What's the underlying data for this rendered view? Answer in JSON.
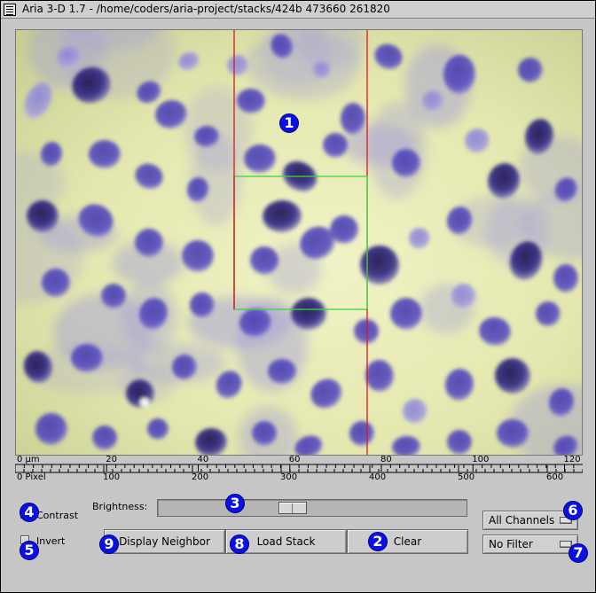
{
  "window": {
    "title": "Aria 3-D 1.7 - /home/coders/aria-project/stacks/424b 473660 261820"
  },
  "ruler": {
    "micron_labels": [
      "0 µm",
      "20",
      "40",
      "60",
      "80",
      "100",
      "120"
    ],
    "micron_values": [
      0,
      20,
      40,
      60,
      80,
      100,
      120
    ],
    "microns_per_pixel": 0.1937,
    "pixel_labels": [
      "0 Pixel",
      "100",
      "200",
      "300",
      "400",
      "500",
      "600"
    ],
    "pixel_values": [
      0,
      100,
      200,
      300,
      400,
      500,
      600
    ]
  },
  "controls": {
    "contrast_label": "Contrast",
    "invert_label": "Invert",
    "brightness_label": "Brightness:",
    "brightness_value_fraction": 0.43,
    "display_neighbor_label": "Display Neighbor",
    "load_stack_label": "Load Stack",
    "clear_label": "Clear",
    "channels_value": "All Channels",
    "filter_value": "No Filter"
  },
  "callouts": [
    "1",
    "2",
    "3",
    "4",
    "5",
    "6",
    "7",
    "8",
    "9"
  ],
  "colors": {
    "selection_outer": "#e0141e",
    "selection_inner": "#3ad83a",
    "callout_badge": "#0a10e6",
    "background_tissue": "#e9ecb6",
    "nucleus_stain": "#5c50b8"
  }
}
